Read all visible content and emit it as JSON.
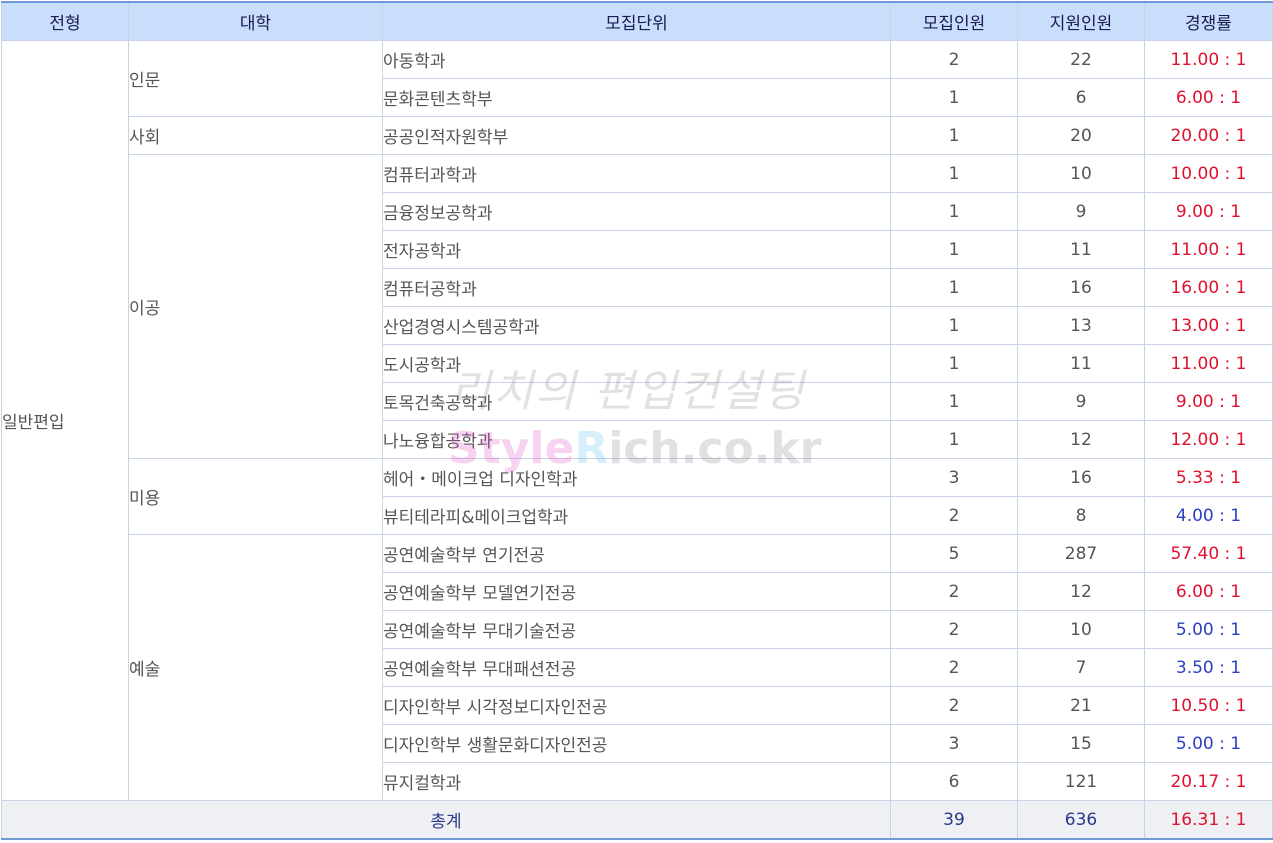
{
  "headers": [
    "전형",
    "대학",
    "모집단위",
    "모집인원",
    "지원인원",
    "경쟁률"
  ],
  "category": "일반편입",
  "groups": [
    {
      "college": "인문",
      "rows": [
        {
          "unit": "아동학과",
          "quota": "2",
          "applicants": "22",
          "ratio": "11.00 : 1",
          "ratio_level": "high"
        },
        {
          "unit": "문화콘텐츠학부",
          "quota": "1",
          "applicants": "6",
          "ratio": "6.00 : 1",
          "ratio_level": "high"
        }
      ]
    },
    {
      "college": "사회",
      "rows": [
        {
          "unit": "공공인적자원학부",
          "quota": "1",
          "applicants": "20",
          "ratio": "20.00 : 1",
          "ratio_level": "high"
        }
      ]
    },
    {
      "college": "이공",
      "rows": [
        {
          "unit": "컴퓨터과학과",
          "quota": "1",
          "applicants": "10",
          "ratio": "10.00 : 1",
          "ratio_level": "high"
        },
        {
          "unit": "금융정보공학과",
          "quota": "1",
          "applicants": "9",
          "ratio": "9.00 : 1",
          "ratio_level": "high"
        },
        {
          "unit": "전자공학과",
          "quota": "1",
          "applicants": "11",
          "ratio": "11.00 : 1",
          "ratio_level": "high"
        },
        {
          "unit": "컴퓨터공학과",
          "quota": "1",
          "applicants": "16",
          "ratio": "16.00 : 1",
          "ratio_level": "high"
        },
        {
          "unit": "산업경영시스템공학과",
          "quota": "1",
          "applicants": "13",
          "ratio": "13.00 : 1",
          "ratio_level": "high"
        },
        {
          "unit": "도시공학과",
          "quota": "1",
          "applicants": "11",
          "ratio": "11.00 : 1",
          "ratio_level": "high"
        },
        {
          "unit": "토목건축공학과",
          "quota": "1",
          "applicants": "9",
          "ratio": "9.00 : 1",
          "ratio_level": "high"
        },
        {
          "unit": "나노융합공학과",
          "quota": "1",
          "applicants": "12",
          "ratio": "12.00 : 1",
          "ratio_level": "high"
        }
      ]
    },
    {
      "college": "미용",
      "rows": [
        {
          "unit": "헤어・메이크업 디자인학과",
          "quota": "3",
          "applicants": "16",
          "ratio": "5.33 : 1",
          "ratio_level": "high"
        },
        {
          "unit": "뷰티테라피&메이크업학과",
          "quota": "2",
          "applicants": "8",
          "ratio": "4.00 : 1",
          "ratio_level": "low"
        }
      ]
    },
    {
      "college": "예술",
      "rows": [
        {
          "unit": "공연예술학부 연기전공",
          "quota": "5",
          "applicants": "287",
          "ratio": "57.40 : 1",
          "ratio_level": "high"
        },
        {
          "unit": "공연예술학부 모델연기전공",
          "quota": "2",
          "applicants": "12",
          "ratio": "6.00 : 1",
          "ratio_level": "high"
        },
        {
          "unit": "공연예술학부 무대기술전공",
          "quota": "2",
          "applicants": "10",
          "ratio": "5.00 : 1",
          "ratio_level": "low"
        },
        {
          "unit": "공연예술학부 무대패션전공",
          "quota": "2",
          "applicants": "7",
          "ratio": "3.50 : 1",
          "ratio_level": "low"
        },
        {
          "unit": "디자인학부 시각정보디자인전공",
          "quota": "2",
          "applicants": "21",
          "ratio": "10.50 : 1",
          "ratio_level": "high"
        },
        {
          "unit": "디자인학부 생활문화디자인전공",
          "quota": "3",
          "applicants": "15",
          "ratio": "5.00 : 1",
          "ratio_level": "low"
        },
        {
          "unit": "뮤지컬학과",
          "quota": "6",
          "applicants": "121",
          "ratio": "20.17 : 1",
          "ratio_level": "high"
        }
      ]
    }
  ],
  "total": {
    "label": "총계",
    "quota": "39",
    "applicants": "636",
    "ratio": "16.31 : 1",
    "ratio_level": "high"
  },
  "watermark": {
    "line1": "리치의 편입컨설팅",
    "line2_a": "Style",
    "line2_b": "R",
    "line2_c": "ich.co.kr"
  },
  "colors": {
    "header_bg": "#c8defb",
    "ratio_high": "#e0102f",
    "ratio_low": "#2d3fc1",
    "border": "#c9d3e6"
  }
}
